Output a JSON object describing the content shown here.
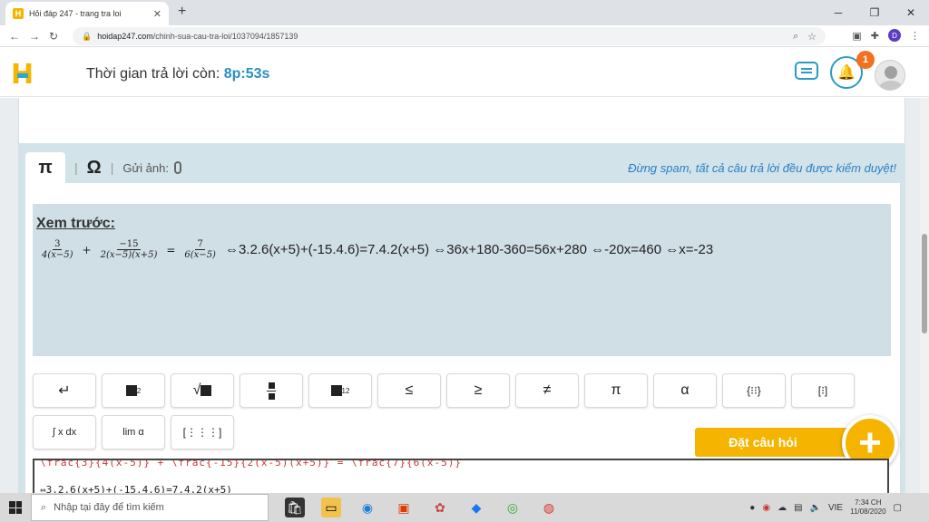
{
  "browser": {
    "tab_title": "Hỏi đáp 247 - trang tra loi",
    "tab_close": "✕",
    "new_tab": "+",
    "url_host": "hoidap247.com",
    "url_path": "/chinh-sua-cau-tra-loi/1037094/1857139"
  },
  "header": {
    "logo": "H",
    "timer_label": "Thời gian trả lời còn: ",
    "timer_value": "8p:53s",
    "notification_count": "1"
  },
  "toolbar": {
    "pi": "π",
    "omega": "Ω",
    "upload_label": "Gửi ảnh:",
    "spam_notice": "Đừng spam, tất cả câu trả lời đều được kiểm duyệt!"
  },
  "preview": {
    "title": "Xem trước:",
    "frac1_num": "3",
    "frac1_den": "4(x−5)",
    "plus": "+",
    "frac2_num": "−15",
    "frac2_den": "2(x−5)(x+5)",
    "equals": "=",
    "frac3_num": "7",
    "frac3_den": "6(x−5)",
    "rest": "⇔3.2.6(x+5)+(-15.4.6)=7.4.2(x+5) ⇔36x+180-360=56x+280 ⇔-20x=460 ⇔x=-23"
  },
  "keys": {
    "enter": "↵",
    "sqrt": "√",
    "le": "≤",
    "ge": "≥",
    "ne": "≠",
    "pi": "π",
    "alpha": "α",
    "integral": "∫ x dx",
    "lim": "lim α",
    "grid": "[⋮⋮⋮]"
  },
  "ask": {
    "label": "Đặt câu hỏi",
    "plus": "+"
  },
  "source": {
    "line1": "\\frac{3}{4(x-5)} + \\frac{-15}{2(x-5)(x+5)} = \\frac{7}{6(x-5)}",
    "line2": "⇔3.2.6(x+5)+(-15.4.6)=7.4.2(x+5)"
  },
  "taskbar": {
    "search_placeholder": "Nhập tại đây để tìm kiếm",
    "lang": "VIE",
    "time": "7:34 CH",
    "date": "11/08/2020"
  },
  "colors": {
    "brand_yellow": "#f5b400",
    "brand_blue": "#2a9bc6",
    "editor_bg": "#d3e3ea",
    "badge_orange": "#f37021"
  }
}
